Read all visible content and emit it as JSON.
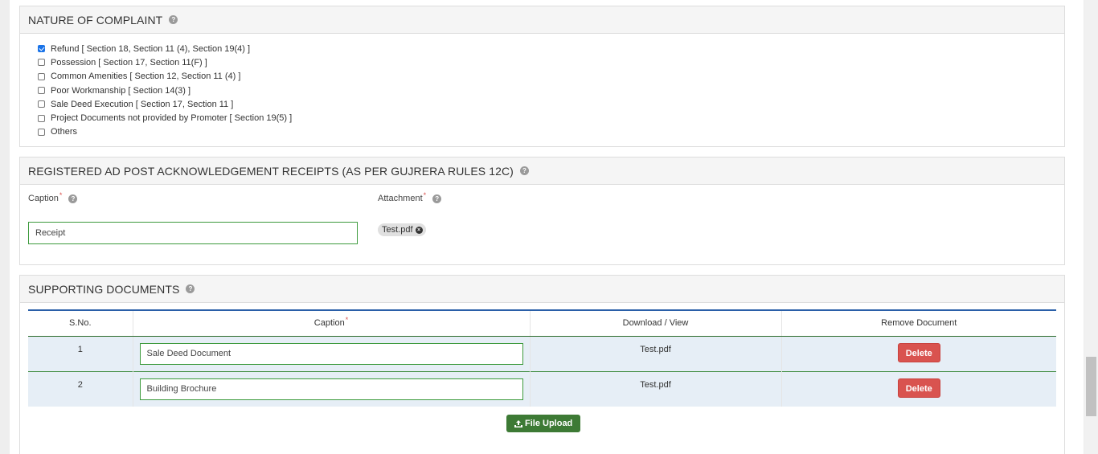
{
  "nature": {
    "title": "NATURE OF COMPLAINT",
    "help": "?",
    "options": [
      {
        "label": "Refund [ Section 18, Section 11 (4), Section 19(4) ]",
        "checked": true
      },
      {
        "label": "Possession [ Section 17, Section 11(F) ]",
        "checked": false
      },
      {
        "label": "Common Amenities [ Section 12, Section 11 (4) ]",
        "checked": false
      },
      {
        "label": "Poor Workmanship [ Section 14(3) ]",
        "checked": false
      },
      {
        "label": "Sale Deed Execution [ Section 17, Section 11 ]",
        "checked": false
      },
      {
        "label": "Project Documents not provided by Promoter [ Section 19(5) ]",
        "checked": false
      },
      {
        "label": "Others",
        "checked": false
      }
    ]
  },
  "receipts": {
    "title": "REGISTERED AD POST ACKNOWLEDGEMENT RECEIPTS (AS PER GUJRERA RULES 12C)",
    "help": "?",
    "caption_label": "Caption",
    "attachment_label": "Attachment",
    "required_mark": "*",
    "caption_value": "Receipt",
    "attachment_file": "Test.pdf",
    "remove_glyph": "×"
  },
  "supporting": {
    "title": "SUPPORTING DOCUMENTS",
    "help": "?",
    "headers": {
      "sno": "S.No.",
      "caption": "Caption",
      "download": "Download / View",
      "remove": "Remove Document"
    },
    "required_mark": "*",
    "rows": [
      {
        "sno": "1",
        "caption": "Sale Deed Document",
        "file": "Test.pdf",
        "action": "Delete"
      },
      {
        "sno": "2",
        "caption": "Building Brochure",
        "file": "Test.pdf",
        "action": "Delete"
      }
    ],
    "upload_label": "File Upload"
  },
  "colors": {
    "primary_checkbox": "#1a73e8",
    "input_border": "#3c9a3c",
    "delete_button": "#d9534f",
    "upload_button": "#3d7a35",
    "table_top_border": "#2a5fa8",
    "row_background": "#e6eef6"
  },
  "icons": {
    "help": "question-circle-icon",
    "remove": "times-circle-icon",
    "upload": "upload-icon"
  }
}
